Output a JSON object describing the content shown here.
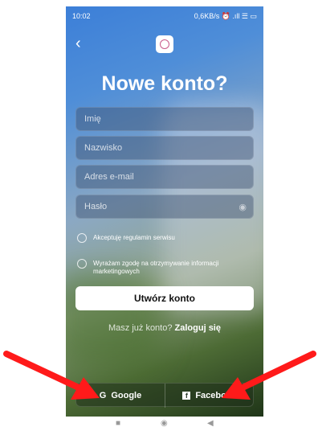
{
  "status_bar": {
    "time": "10:02",
    "right": "0,6KB/s ⏰ .ıll ☰ ▭"
  },
  "header": {
    "back_icon": "‹",
    "title": "Nowe konto?"
  },
  "form": {
    "first_name_placeholder": "Imię",
    "last_name_placeholder": "Nazwisko",
    "email_placeholder": "Adres e-mail",
    "password_placeholder": "Hasło"
  },
  "checkboxes": {
    "terms_label": "Akceptuję regulamin serwisu",
    "marketing_label": "Wyrażam zgodę na otrzymywanie informacji marketingowych"
  },
  "create_button_label": "Utwórz konto",
  "login": {
    "prompt": "Masz już konto?",
    "link": "Zaloguj się"
  },
  "social": {
    "google_label": "Google",
    "facebook_label": "Facebook",
    "google_icon": "G",
    "facebook_icon": "f"
  },
  "colors": {
    "arrow": "#ff1a1a",
    "button_bg": "#ffffff"
  },
  "nav_bar": {
    "square": "■",
    "home": "◉",
    "back": "◀"
  }
}
